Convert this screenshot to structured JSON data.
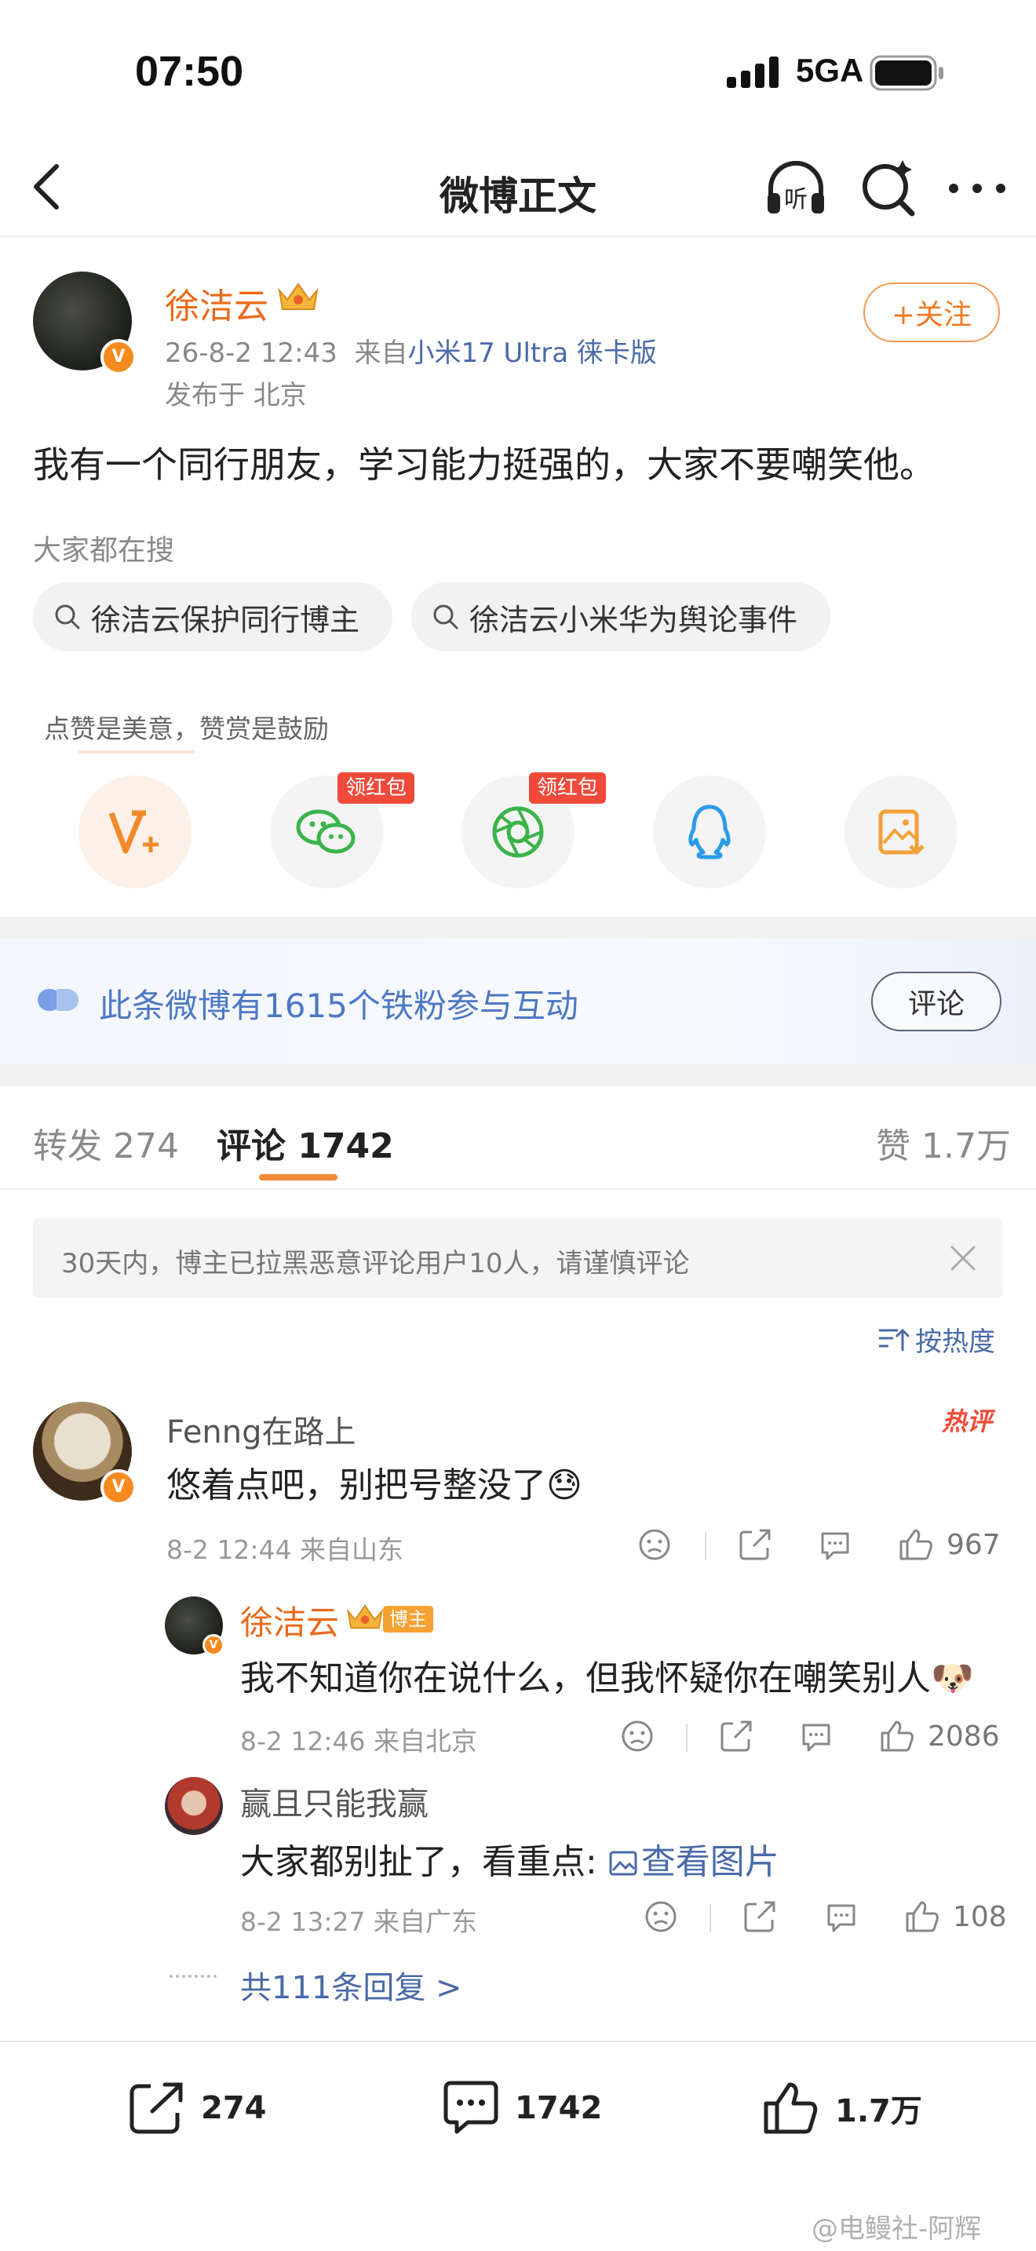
{
  "status_bar": {
    "time": "07:50",
    "network": "5GA"
  },
  "nav": {
    "title": "微博正文",
    "listen_label": "听"
  },
  "post": {
    "author": "徐洁云",
    "verified_mark": "V",
    "time": "26-8-2 12:43",
    "source_prefix": "来自",
    "source": "小米17 Ultra 徕卡版",
    "location": "发布于 北京",
    "follow_label": "+关注",
    "content": "我有一个同行朋友，学习能力挺强的，大家不要嘲笑他。"
  },
  "search_section": {
    "label": "大家都在搜",
    "chips": [
      "徐洁云保护同行博主",
      "徐洁云小米华为舆论事件"
    ]
  },
  "share": {
    "tip": "点赞是美意，赞赏是鼓励",
    "red_packet_tag": "领红包",
    "items": [
      "reward",
      "wechat",
      "moments",
      "qq",
      "save-image"
    ]
  },
  "fan_banner": {
    "text": "此条微博有1615个铁粉参与互动",
    "button": "评论"
  },
  "tabs": {
    "repost": "转发 274",
    "comment": "评论 1742",
    "like": "赞 1.7万"
  },
  "notice": {
    "text": "30天内，博主已拉黑恶意评论用户10人，请谨慎评论"
  },
  "sort_label": "按热度",
  "comments": [
    {
      "name": "Fenng在路上",
      "badge": "热评",
      "text": "悠着点吧，别把号整没了😓",
      "meta": "8-2 12:44  来自山东",
      "likes": "967"
    }
  ],
  "replies": [
    {
      "name": "徐洁云",
      "host_badge": "博主",
      "text": "我不知道你在说什么，但我怀疑你在嘲笑别人🐶",
      "meta": "8-2 12:46  来自北京",
      "likes": "2086"
    },
    {
      "name": "赢且只能我赢",
      "text_prefix": "大家都别扯了，看重点: ",
      "link_text": "查看图片",
      "meta": "8-2 13:27  来自广东",
      "likes": "108"
    }
  ],
  "more_replies": "共111条回复 >",
  "bottom_bar": {
    "repost": "274",
    "comment": "1742",
    "like": "1.7万"
  },
  "watermark": "@电鳗社-阿辉",
  "colors": {
    "accent_orange": "#f07a24",
    "link_blue": "#4a6aa8",
    "hot_red": "#f04c3c"
  }
}
